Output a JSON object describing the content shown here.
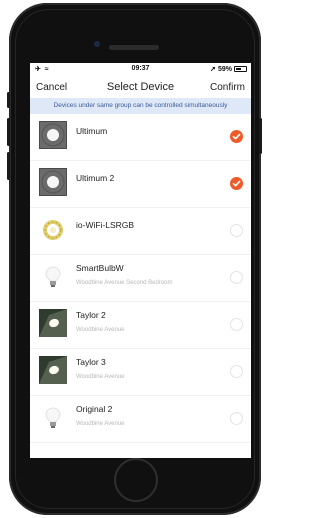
{
  "status_bar": {
    "left": "✈ ≈",
    "time": "09:37",
    "location_icon": "location-arrow-icon",
    "battery": "59%",
    "battery_level": 0.59
  },
  "nav": {
    "cancel": "Cancel",
    "title": "Select Device",
    "confirm": "Confirm"
  },
  "info_banner": "Devices under same group can be controlled simultaneously",
  "colors": {
    "accent": "#f05a28",
    "banner_bg": "#dfe8f6",
    "banner_text": "#3a5c9c",
    "subtitle": "#b8b8b8"
  },
  "devices": [
    {
      "name": "Ultimum",
      "subtitle": "",
      "icon": "downlight-photo-icon",
      "selected": true
    },
    {
      "name": "Ultimum 2",
      "subtitle": "",
      "icon": "downlight-photo-icon",
      "selected": true
    },
    {
      "name": "io-WiFi-LSRGB",
      "subtitle": "",
      "icon": "led-strip-icon",
      "selected": false
    },
    {
      "name": "SmartBulbW",
      "subtitle": "Woodbine Avenue Second Bedroom",
      "icon": "bulb-icon",
      "selected": false
    },
    {
      "name": "Taylor 2",
      "subtitle": "Woodbine Avenue",
      "icon": "spotlight-photo-icon",
      "selected": false
    },
    {
      "name": "Taylor 3",
      "subtitle": "Woodbine Avenue",
      "icon": "spotlight-photo-icon",
      "selected": false
    },
    {
      "name": "Original 2",
      "subtitle": "Woodbine Avenue",
      "icon": "bulb-icon",
      "selected": false
    }
  ]
}
